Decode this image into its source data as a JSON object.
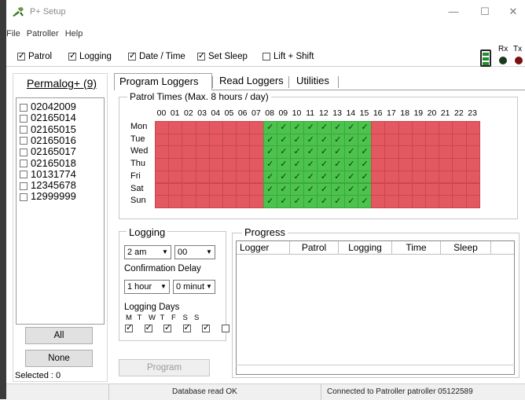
{
  "window": {
    "title": "P+ Setup",
    "minimize": "—",
    "maximize": "☐",
    "close": "✕"
  },
  "menu": [
    "File",
    "Patroller",
    "Help"
  ],
  "toolbar": {
    "options": [
      {
        "label": "Patrol",
        "checked": true
      },
      {
        "label": "Logging",
        "checked": true
      },
      {
        "label": "Date / Time",
        "checked": true
      },
      {
        "label": "Set Sleep",
        "checked": true
      },
      {
        "label": "Lift + Shift",
        "checked": false
      }
    ],
    "rx_label": "Rx",
    "tx_label": "Tx",
    "rx_color": "#1a3a1a",
    "tx_color": "#7a1010"
  },
  "left": {
    "title": "Permalog+ (9)",
    "items": [
      "02042009",
      "02165014",
      "02165015",
      "02165016",
      "02165017",
      "02165018",
      "10131774",
      "12345678",
      "12999999"
    ],
    "all_button": "All",
    "none_button": "None",
    "selected_label": "Selected : 0"
  },
  "tabs": [
    "Program Loggers",
    "Read Loggers",
    "Utilities"
  ],
  "patrol": {
    "title": "Patrol Times (Max. 8 hours / day)",
    "hours": [
      "00",
      "01",
      "02",
      "03",
      "04",
      "05",
      "06",
      "07",
      "08",
      "09",
      "10",
      "11",
      "12",
      "13",
      "14",
      "15",
      "16",
      "17",
      "18",
      "19",
      "20",
      "21",
      "22",
      "23"
    ],
    "days": [
      "Mon",
      "Tue",
      "Wed",
      "Thu",
      "Fri",
      "Sat",
      "Sun"
    ],
    "active_hours": [
      8,
      9,
      10,
      11,
      12,
      13,
      14,
      15
    ],
    "check_glyph": "✓",
    "active_color": "#4cc34c",
    "inactive_color": "#e45961"
  },
  "logging": {
    "title": "Logging",
    "hour_value": "2 am",
    "minute_value": "00",
    "confirmation_label": "Confirmation Delay",
    "delay_hour": "1 hour",
    "delay_minute": "0 minut",
    "days_title": "Logging Days",
    "day_letters": [
      "M",
      "T",
      "W",
      "T",
      "F",
      "S",
      "S"
    ],
    "day_checks": [
      true,
      true,
      true,
      true,
      true,
      false,
      false
    ],
    "program_button": "Program"
  },
  "progress": {
    "title": "Progress",
    "columns": [
      "Logger",
      "Patrol",
      "Logging",
      "Time",
      "Sleep"
    ]
  },
  "status": {
    "db": "Database read OK",
    "connection": "Connected to Patroller patroller 05122589"
  }
}
